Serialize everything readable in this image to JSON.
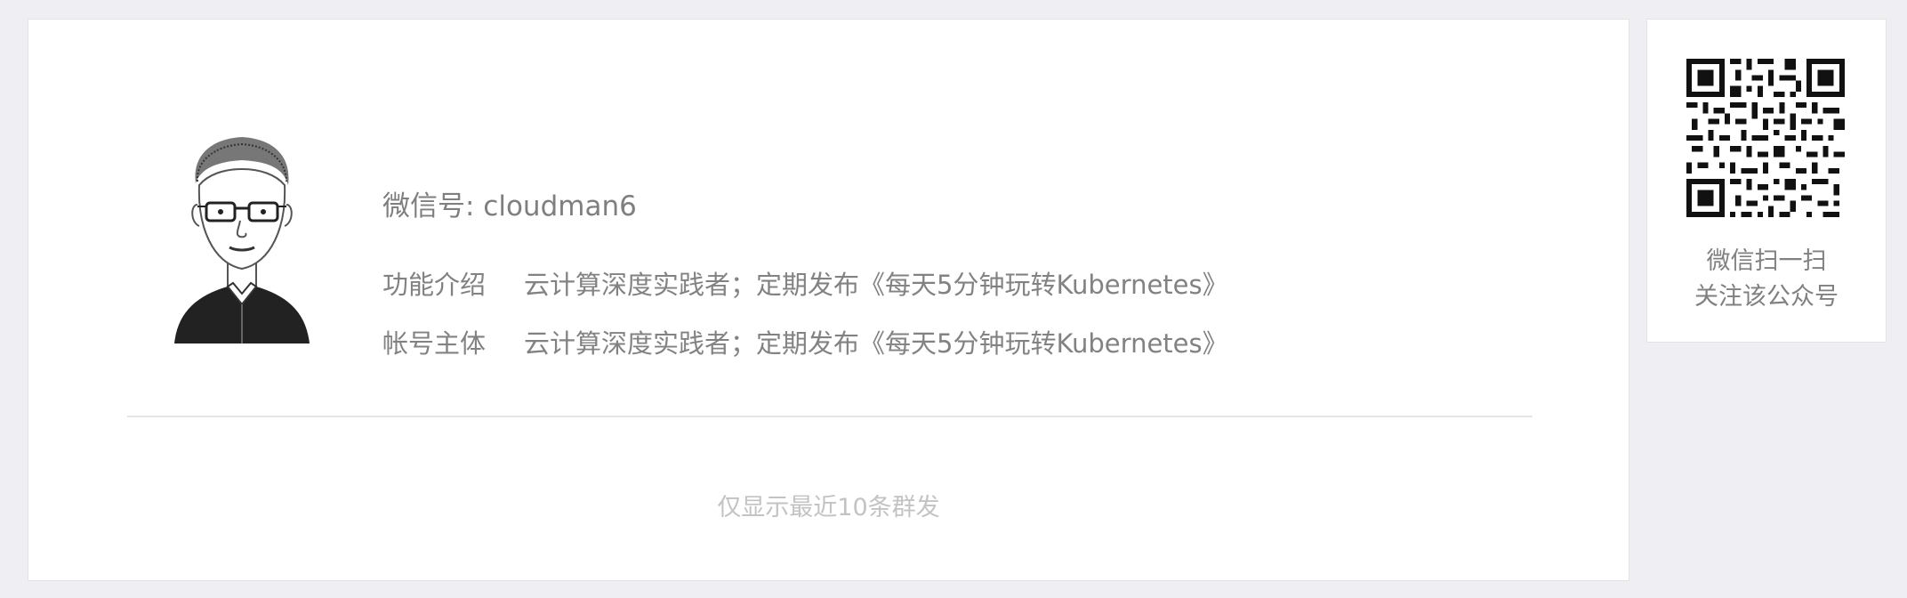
{
  "profile": {
    "wechat_id_label": "微信号: cloudman6",
    "rows": [
      {
        "label": "功能介绍",
        "value": "云计算深度实践者；定期发布《每天5分钟玩转Kubernetes》"
      },
      {
        "label": "帐号主体",
        "value": "云计算深度实践者；定期发布《每天5分钟玩转Kubernetes》"
      }
    ],
    "footer_note": "仅显示最近10条群发"
  },
  "qr": {
    "caption_line1": "微信扫一扫",
    "caption_line2": "关注该公众号"
  },
  "icons": {
    "avatar": "avatar-sketch",
    "qr": "qr-code-icon"
  },
  "colors": {
    "page_bg": "#eeeef3",
    "card_bg": "#ffffff",
    "text": "#808080",
    "muted": "#c3c3c3"
  }
}
